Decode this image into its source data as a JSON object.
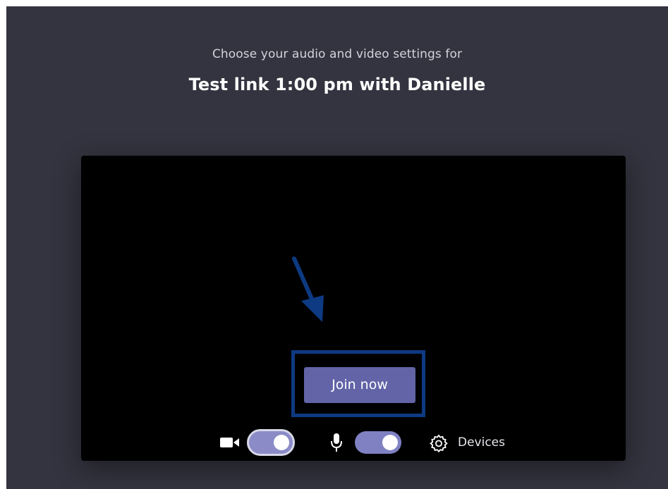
{
  "header": {
    "subtitle": "Choose your audio and video settings for",
    "meeting_title": "Test link 1:00 pm with Danielle"
  },
  "preview": {
    "join_button_label": "Join now"
  },
  "controls": {
    "video_toggle_on": true,
    "audio_toggle_on": true,
    "devices_label": "Devices"
  },
  "icons": {
    "camera": "camera-icon",
    "microphone": "microphone-icon",
    "gear": "gear-icon",
    "annotation_arrow": "arrow-icon"
  },
  "colors": {
    "background": "#33343f",
    "preview": "#000000",
    "accent": "#6264a7",
    "highlight_border": "#0d3a82"
  }
}
